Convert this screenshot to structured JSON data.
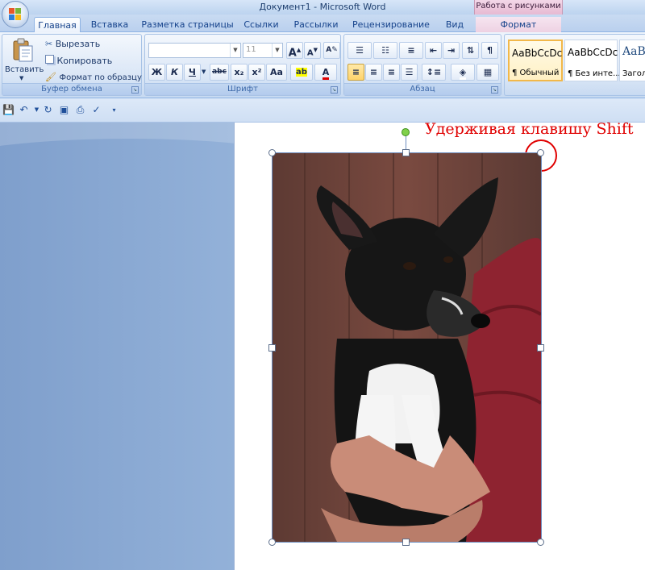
{
  "window": {
    "title": "Документ1 - Microsoft Word",
    "context_tab_group": "Работа с рисунками"
  },
  "tabs": [
    "Главная",
    "Вставка",
    "Разметка страницы",
    "Ссылки",
    "Рассылки",
    "Рецензирование",
    "Вид",
    "Формат"
  ],
  "clipboard": {
    "paste_label": "Вставить",
    "cut_label": "Вырезать",
    "copy_label": "Копировать",
    "format_painter_label": "Формат по образцу",
    "group_label": "Буфер обмена"
  },
  "font": {
    "font_name_value": "",
    "font_size_value": "11",
    "bold_label": "Ж",
    "italic_label": "К",
    "underline_label": "Ч",
    "strike_label": "abc",
    "subscript_label": "x₂",
    "superscript_label": "x²",
    "case_label": "Aa",
    "grow_label": "A",
    "shrink_label": "A",
    "highlight_label": "ab",
    "color_label": "A",
    "group_label": "Шрифт"
  },
  "paragraph": {
    "group_label": "Абзац"
  },
  "styles": [
    {
      "sample": "AaBbCcDc",
      "name": "¶ Обычный"
    },
    {
      "sample": "AaBbCcDc",
      "name": "¶ Без инте..."
    },
    {
      "sample": "AaB",
      "name": "Заголо"
    }
  ],
  "annotation": "Удерживая клавишу Shift",
  "colors": {
    "annotation": "#e00000",
    "ribbon": "#d7e4f5",
    "context_tab": "#e7b9d2",
    "rotate_handle": "#7fd04a"
  }
}
